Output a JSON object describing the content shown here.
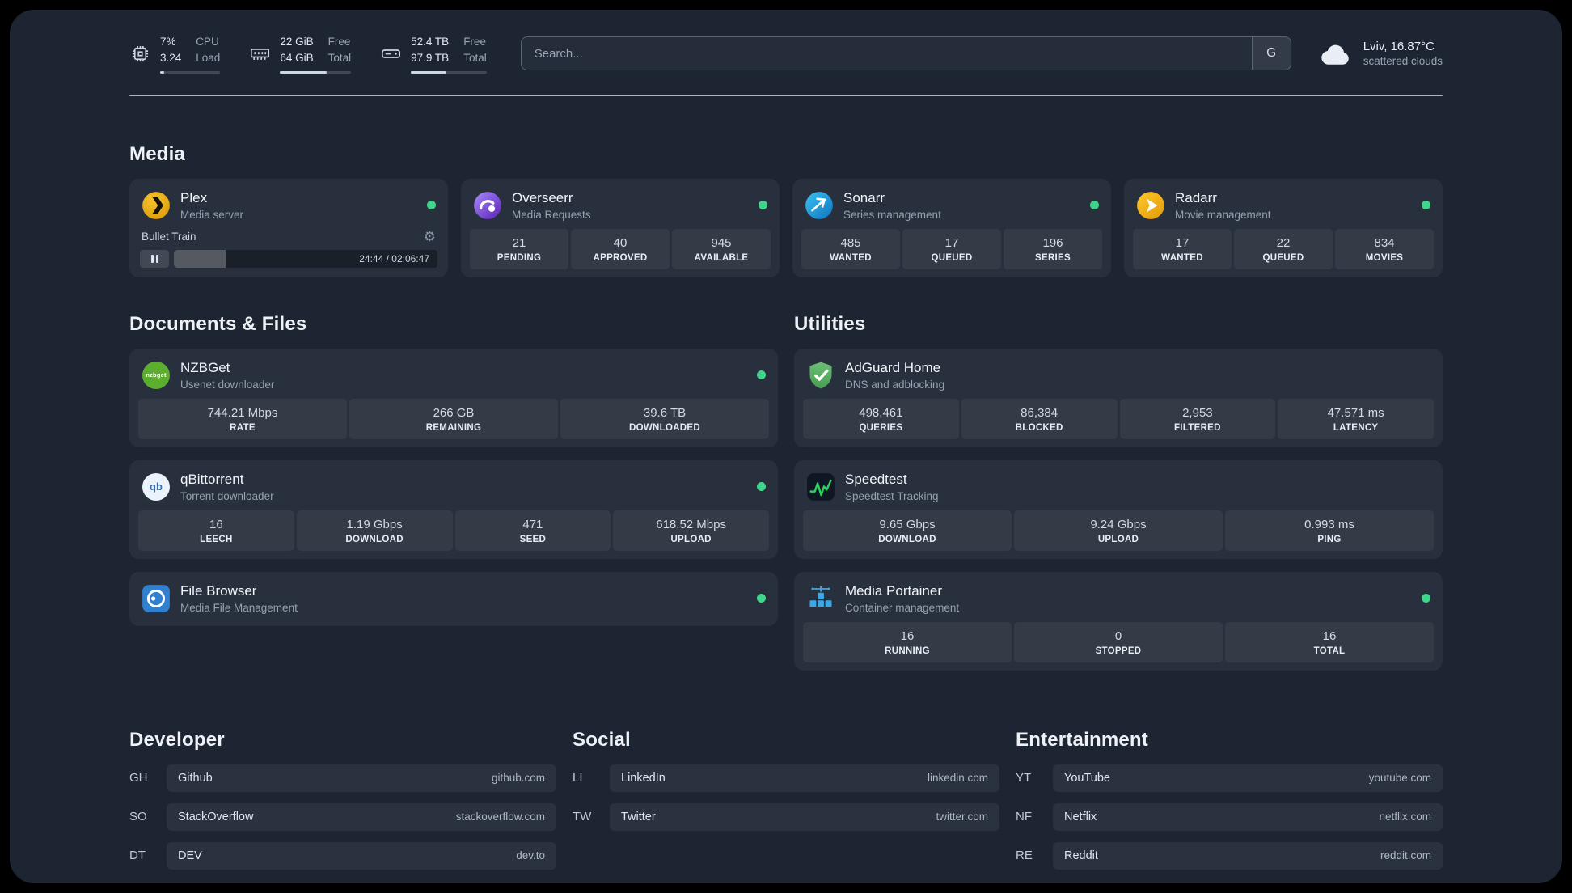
{
  "colors": {
    "status_online": "#3fd68c"
  },
  "topbar": {
    "resources": [
      {
        "icon": "cpu",
        "values": [
          "7%",
          "3.24"
        ],
        "labels": [
          "CPU",
          "Load"
        ],
        "bar_percent": 7
      },
      {
        "icon": "memory",
        "values": [
          "22 GiB",
          "64 GiB"
        ],
        "labels": [
          "Free",
          "Total"
        ],
        "bar_percent": 66
      },
      {
        "icon": "disk",
        "values": [
          "52.4 TB",
          "97.9 TB"
        ],
        "labels": [
          "Free",
          "Total"
        ],
        "bar_percent": 47
      }
    ],
    "search": {
      "placeholder": "Search...",
      "provider_label": "G"
    },
    "weather": {
      "location": "Lviv, 16.87°C",
      "condition": "scattered clouds"
    }
  },
  "sections": {
    "media": {
      "title": "Media",
      "services": [
        {
          "name": "Plex",
          "description": "Media server",
          "icon": "plex",
          "online": true,
          "player": {
            "title": "Bullet Train",
            "time": "24:44 / 02:06:47",
            "progress_percent": 19.5
          }
        },
        {
          "name": "Overseerr",
          "description": "Media Requests",
          "icon": "overseerr",
          "online": true,
          "stats": [
            {
              "value": "21",
              "label": "PENDING"
            },
            {
              "value": "40",
              "label": "APPROVED"
            },
            {
              "value": "945",
              "label": "AVAILABLE"
            }
          ]
        },
        {
          "name": "Sonarr",
          "description": "Series management",
          "icon": "sonarr",
          "online": true,
          "stats": [
            {
              "value": "485",
              "label": "WANTED"
            },
            {
              "value": "17",
              "label": "QUEUED"
            },
            {
              "value": "196",
              "label": "SERIES"
            }
          ]
        },
        {
          "name": "Radarr",
          "description": "Movie management",
          "icon": "radarr",
          "online": true,
          "stats": [
            {
              "value": "17",
              "label": "WANTED"
            },
            {
              "value": "22",
              "label": "QUEUED"
            },
            {
              "value": "834",
              "label": "MOVIES"
            }
          ]
        }
      ]
    },
    "documents": {
      "title": "Documents & Files",
      "services": [
        {
          "name": "NZBGet",
          "description": "Usenet downloader",
          "icon": "nzbget",
          "online": true,
          "stats": [
            {
              "value": "744.21 Mbps",
              "label": "RATE"
            },
            {
              "value": "266 GB",
              "label": "REMAINING"
            },
            {
              "value": "39.6 TB",
              "label": "DOWNLOADED"
            }
          ]
        },
        {
          "name": "qBittorrent",
          "description": "Torrent downloader",
          "icon": "qbittorrent",
          "online": true,
          "stats": [
            {
              "value": "16",
              "label": "LEECH"
            },
            {
              "value": "1.19 Gbps",
              "label": "DOWNLOAD"
            },
            {
              "value": "471",
              "label": "SEED"
            },
            {
              "value": "618.52 Mbps",
              "label": "UPLOAD"
            }
          ]
        },
        {
          "name": "File Browser",
          "description": "Media File Management",
          "icon": "filebrowser",
          "online": true,
          "stats": []
        }
      ]
    },
    "utilities": {
      "title": "Utilities",
      "services": [
        {
          "name": "AdGuard Home",
          "description": "DNS and adblocking",
          "icon": "adguard",
          "online": false,
          "stats": [
            {
              "value": "498,461",
              "label": "QUERIES"
            },
            {
              "value": "86,384",
              "label": "BLOCKED"
            },
            {
              "value": "2,953",
              "label": "FILTERED"
            },
            {
              "value": "47.571 ms",
              "label": "LATENCY"
            }
          ]
        },
        {
          "name": "Speedtest",
          "description": "Speedtest Tracking",
          "icon": "speedtest",
          "online": false,
          "stats": [
            {
              "value": "9.65 Gbps",
              "label": "DOWNLOAD"
            },
            {
              "value": "9.24 Gbps",
              "label": "UPLOAD"
            },
            {
              "value": "0.993 ms",
              "label": "PING"
            }
          ]
        },
        {
          "name": "Media Portainer",
          "description": "Container management",
          "icon": "portainer",
          "online": true,
          "stats": [
            {
              "value": "16",
              "label": "RUNNING"
            },
            {
              "value": "0",
              "label": "STOPPED"
            },
            {
              "value": "16",
              "label": "TOTAL"
            }
          ]
        }
      ]
    }
  },
  "bookmarks": [
    {
      "title": "Developer",
      "items": [
        {
          "abbr": "GH",
          "name": "Github",
          "url": "github.com"
        },
        {
          "abbr": "SO",
          "name": "StackOverflow",
          "url": "stackoverflow.com"
        },
        {
          "abbr": "DT",
          "name": "DEV",
          "url": "dev.to"
        }
      ]
    },
    {
      "title": "Social",
      "items": [
        {
          "abbr": "LI",
          "name": "LinkedIn",
          "url": "linkedin.com"
        },
        {
          "abbr": "TW",
          "name": "Twitter",
          "url": "twitter.com"
        }
      ]
    },
    {
      "title": "Entertainment",
      "items": [
        {
          "abbr": "YT",
          "name": "YouTube",
          "url": "youtube.com"
        },
        {
          "abbr": "NF",
          "name": "Netflix",
          "url": "netflix.com"
        },
        {
          "abbr": "RE",
          "name": "Reddit",
          "url": "reddit.com"
        }
      ]
    }
  ]
}
